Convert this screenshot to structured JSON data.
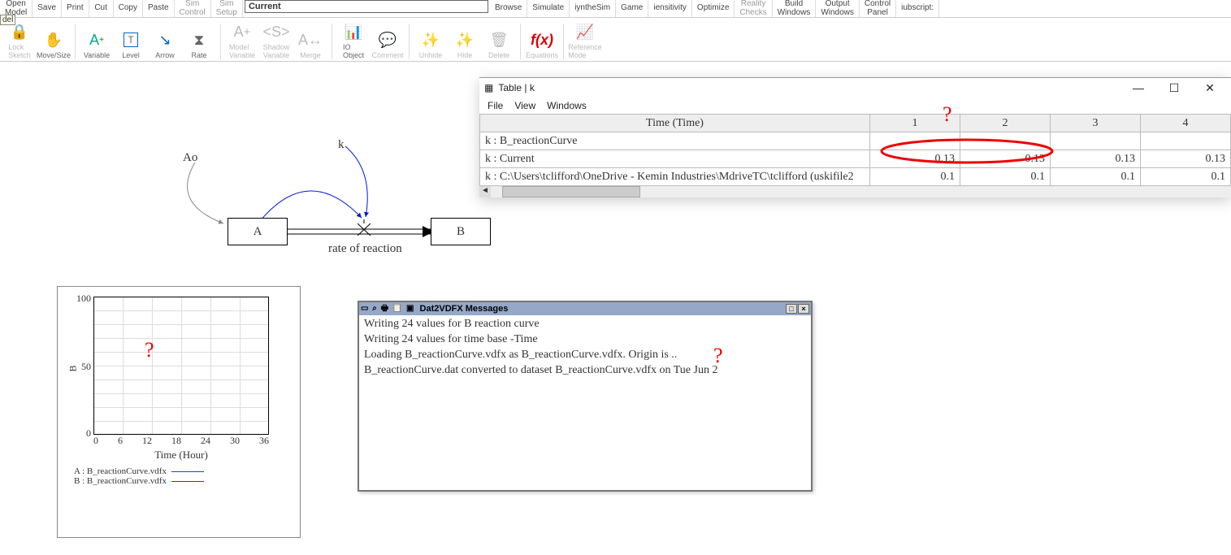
{
  "ribbon1": {
    "open_model": "Open\nModel",
    "save": "Save",
    "print": "Print",
    "cut": "Cut",
    "copy": "Copy",
    "paste": "Paste",
    "sim_control": "Sim\nControl",
    "sim_setup": "Sim\nSetup",
    "current_field": "Current",
    "browse": "Browse",
    "simulate": "Simulate",
    "synthesim": "iyntheSim",
    "game": "Game",
    "sensitivity": "iensitivity",
    "optimize": "Optimize",
    "reality_checks": "Reality\nChecks",
    "build_windows": "Build\nWindows",
    "output_windows": "Output\nWindows",
    "control_panel": "Control\nPanel",
    "subscript": "iubscript:"
  },
  "tag_del": "del",
  "ribbon2": {
    "lock_sketch": "Lock\nSketch",
    "move_size": "Move/Size",
    "variable": "Variable",
    "level": "Level",
    "arrow": "Arrow",
    "rate": "Rate",
    "model_variable": "Model\nVariable",
    "shadow_variable": "Shadow\nVariable",
    "merge": "Merge",
    "io_object": "IO\nObject",
    "comment": "Comment",
    "unhide": "Unhide",
    "hide": "Hide",
    "delete": "Delete",
    "equations": "Equations",
    "reference_mode": "Reference\nMode",
    "fx": "f(x)"
  },
  "diagram": {
    "Ao": "Ao",
    "k": "k",
    "A": "A",
    "B": "B",
    "rate": "rate of reaction"
  },
  "table": {
    "title": "Table | k",
    "menu": {
      "file": "File",
      "view": "View",
      "windows": "Windows"
    },
    "header_time": "Time (Time)",
    "cols": [
      "1",
      "2",
      "3",
      "4"
    ],
    "rows": [
      {
        "label": "k : B_reactionCurve",
        "vals": [
          "",
          "",
          "",
          ""
        ]
      },
      {
        "label": "k : Current",
        "vals": [
          "0.13",
          "0.13",
          "0.13",
          "0.13"
        ]
      },
      {
        "label": "k : C:\\Users\\tclifford\\OneDrive - Kemin Industries\\MdriveTC\\tclifford (uskifile2",
        "vals": [
          "0.1",
          "0.1",
          "0.1",
          "0.1"
        ]
      }
    ]
  },
  "chart": {
    "ylabel": "B",
    "yticks": [
      "100",
      "50",
      "0"
    ],
    "xticks": [
      "0",
      "6",
      "12",
      "18",
      "24",
      "30",
      "36"
    ],
    "xlabel": "Time (Hour)",
    "legend": [
      {
        "text": "A : B_reactionCurve.vdfx",
        "color": "#1040ff"
      },
      {
        "text": "B : B_reactionCurve.vdfx",
        "color": "#e00000"
      }
    ]
  },
  "chart_data": {
    "type": "line",
    "title": "",
    "xlabel": "Time (Hour)",
    "ylabel": "B",
    "xlim": [
      0,
      36
    ],
    "ylim": [
      0,
      100
    ],
    "series": [
      {
        "name": "A : B_reactionCurve.vdfx",
        "x": [],
        "values": []
      },
      {
        "name": "B : B_reactionCurve.vdfx",
        "x": [],
        "values": []
      }
    ],
    "note": "No data points visible in plot area."
  },
  "messages": {
    "title": "Dat2VDFX Messages",
    "lines": [
      "Writing 24 values for B reaction curve",
      "Writing 24 values for time base -Time",
      "Loading B_reactionCurve.vdfx as B_reactionCurve.vdfx.  Origin is ..",
      "B_reactionCurve.dat converted to dataset B_reactionCurve.vdfx on Tue Jun 2"
    ]
  }
}
